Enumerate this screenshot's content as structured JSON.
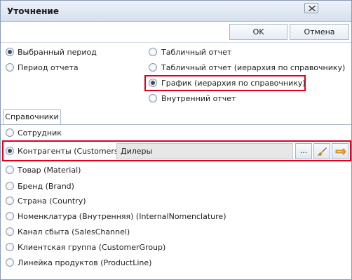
{
  "window": {
    "title": "Уточнение"
  },
  "buttons": {
    "ok": "OK",
    "cancel": "Отмена"
  },
  "period_options": [
    {
      "label": "Выбранный период",
      "selected": true
    },
    {
      "label": "Период отчета",
      "selected": false
    }
  ],
  "report_options": [
    {
      "label": "Табличный отчет",
      "selected": false
    },
    {
      "label": "Табличный отчет (иерархия по справочнику)",
      "selected": false
    },
    {
      "label": "График (иерархия по справочнику)",
      "selected": true
    },
    {
      "label": "Внутренний отчет",
      "selected": false
    }
  ],
  "tab": {
    "label": "Справочники"
  },
  "directories": [
    {
      "label": "Сотрудник",
      "selected": false
    },
    {
      "label": "Контрагенты (Customers)",
      "selected": true,
      "value": "Дилеры"
    },
    {
      "label": "Товар  (Material)",
      "selected": false
    },
    {
      "label": "Бренд (Brand)",
      "selected": false
    },
    {
      "label": "Страна (Country)",
      "selected": false
    },
    {
      "label": "Номенклатура (Внутренняя) (InternalNomenclature)",
      "selected": false
    },
    {
      "label": "Канал сбыта (SalesChannel)",
      "selected": false
    },
    {
      "label": "Клиентская группа (CustomerGroup)",
      "selected": false
    },
    {
      "label": "Линейка продуктов (ProductLine)",
      "selected": false
    }
  ],
  "field_buttons": {
    "browse": "...",
    "clear_icon": "broom-icon",
    "link_icon": "link-icon"
  },
  "colors": {
    "highlight": "#e1001b",
    "title_bg": "#dbe4f0",
    "accent_icon": "#e0a23a"
  }
}
